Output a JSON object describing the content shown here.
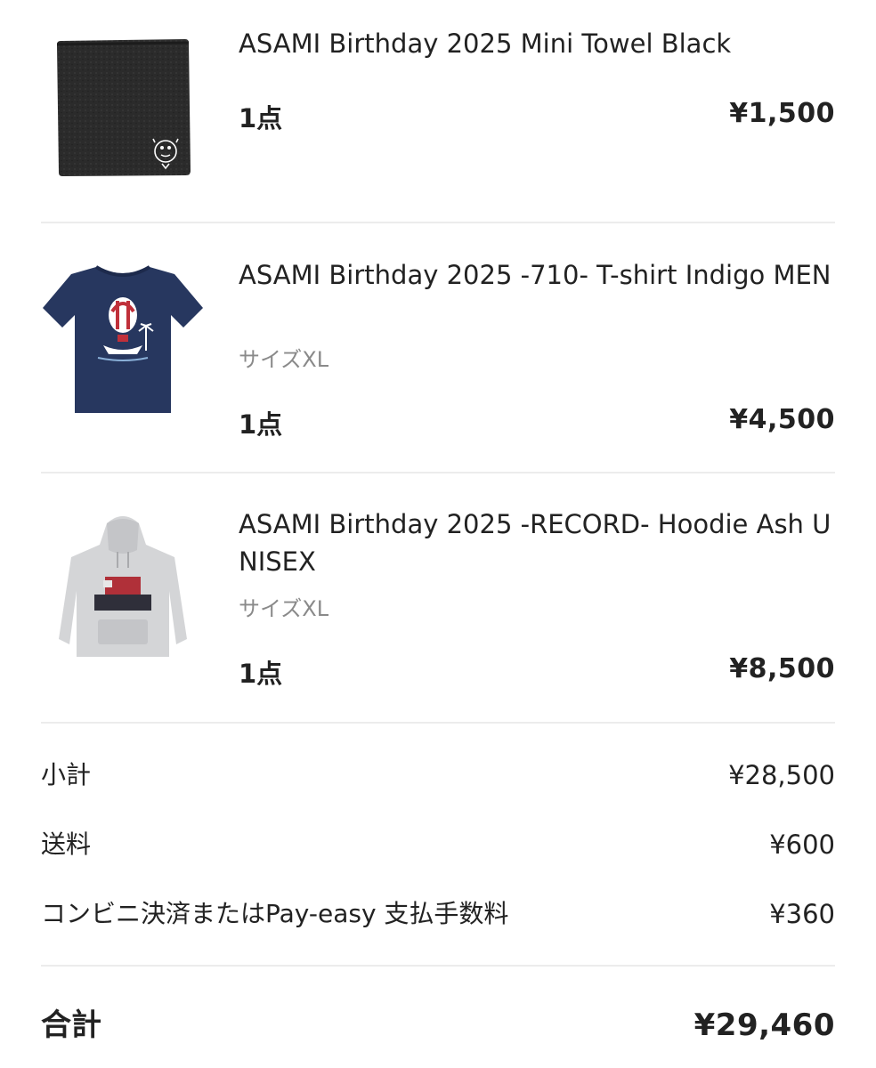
{
  "items": [
    {
      "title": "ASAMI Birthday 2025 Mini Towel Black",
      "size": "",
      "quantity": "1点",
      "price": "¥1,500",
      "thumb_icon": "towel-icon",
      "thumb_color": "#2b2b2b"
    },
    {
      "title": "ASAMI Birthday 2025 -710- T-shirt Indigo MEN",
      "size": "サイズXL",
      "quantity": "1点",
      "price": "¥4,500",
      "thumb_icon": "tshirt-icon",
      "thumb_color": "#27375f"
    },
    {
      "title": "ASAMI Birthday 2025 -RECORD- Hoodie Ash UNISEX",
      "size": "サイズXL",
      "quantity": "1点",
      "price": "¥8,500",
      "thumb_icon": "hoodie-icon",
      "thumb_color": "#d4d5d7"
    }
  ],
  "summary": {
    "subtotal_label": "小計",
    "subtotal_value": "¥28,500",
    "shipping_label": "送料",
    "shipping_value": "¥600",
    "fee_label": "コンビニ決済またはPay-easy 支払手数料",
    "fee_value": "¥360",
    "total_label": "合計",
    "total_value": "¥29,460"
  }
}
